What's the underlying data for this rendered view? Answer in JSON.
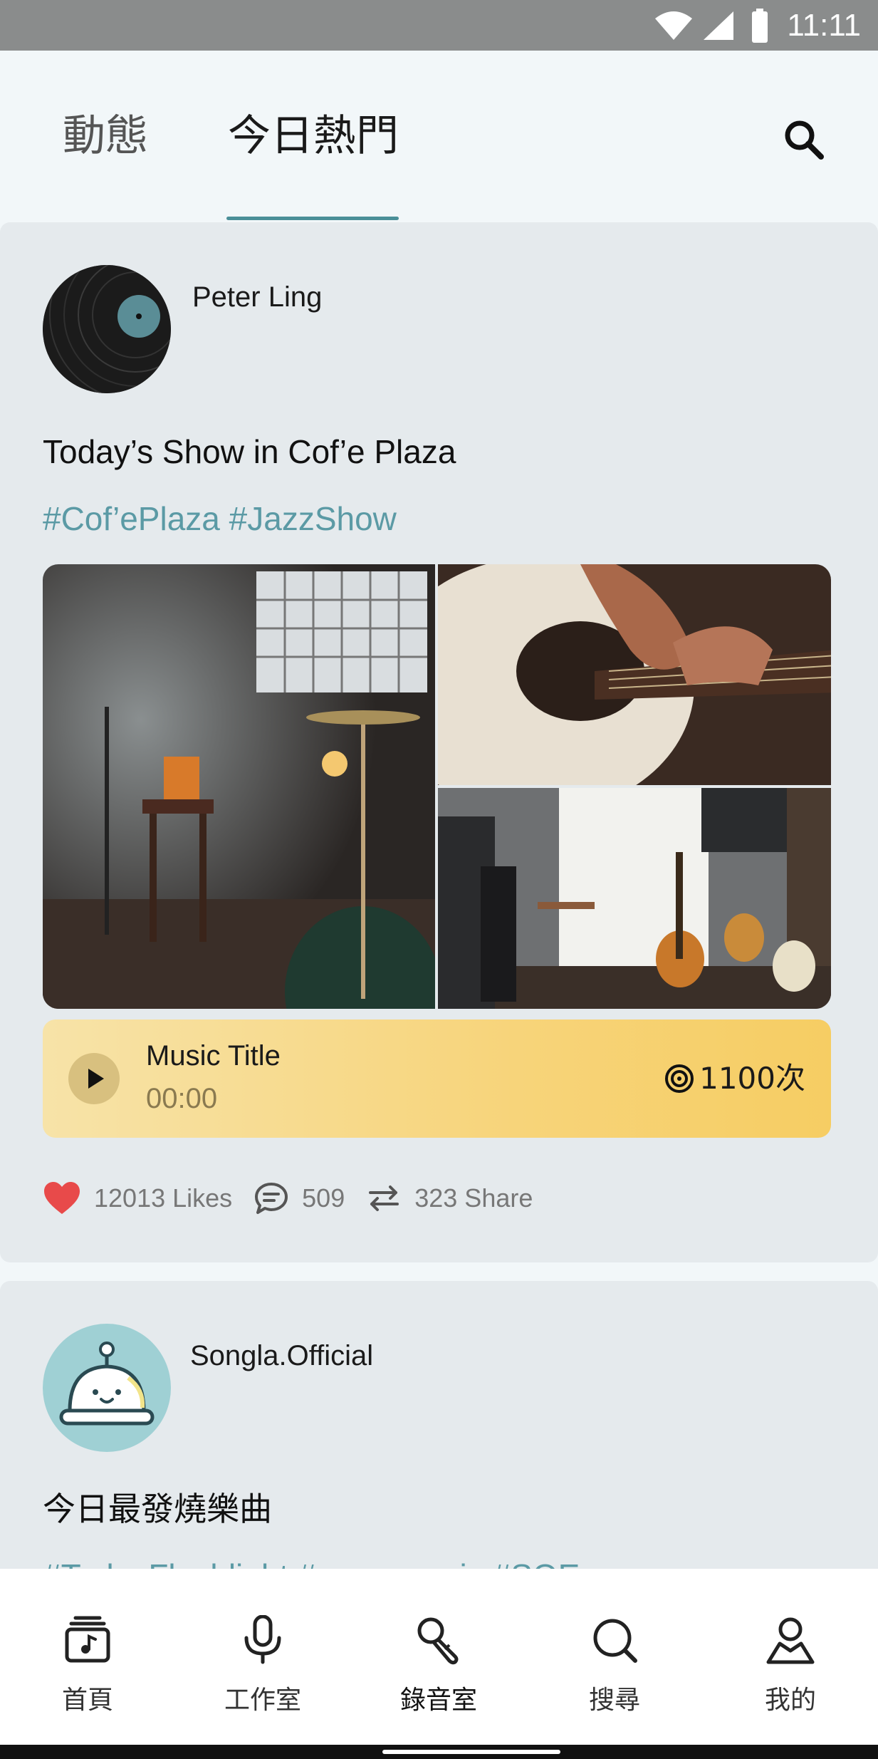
{
  "status_bar": {
    "time": "11:11"
  },
  "tabs": [
    {
      "label": "動態",
      "active": false
    },
    {
      "label": "今日熱門",
      "active": true
    }
  ],
  "posts": [
    {
      "author": "Peter Ling",
      "title": "Today’s Show in Cof’e Plaza",
      "hashtags": "#Cof’ePlaza #JazzShow",
      "music": {
        "title": "Music Title",
        "time": "00:00",
        "plays": "1100次"
      },
      "likes": "12013 Likes",
      "comments": "509",
      "shares": "323 Share"
    },
    {
      "author": "Songla.Official",
      "title": "今日最發燒樂曲",
      "hashtags": "#TodayFlashlight #supermusic #SOE"
    }
  ],
  "bottom_nav": [
    {
      "label": "首頁",
      "icon": "music-album-icon"
    },
    {
      "label": "工作室",
      "icon": "microphone-icon"
    },
    {
      "label": "錄音室",
      "icon": "karaoke-mic-icon",
      "active": true
    },
    {
      "label": "搜尋",
      "icon": "search-icon"
    },
    {
      "label": "我的",
      "icon": "profile-icon"
    }
  ],
  "colors": {
    "accent": "#4a8f98",
    "hashtag": "#5b9aa5",
    "player": "#f7d47a",
    "heart": "#e84a4a"
  }
}
